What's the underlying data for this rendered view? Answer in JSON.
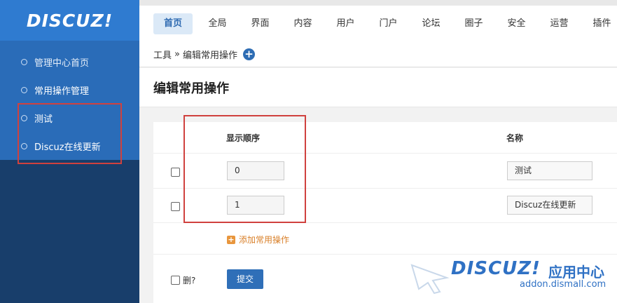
{
  "sidebar": {
    "logo": "DISCUZ!",
    "items": [
      {
        "label": "管理中心首页"
      },
      {
        "label": "常用操作管理"
      },
      {
        "label": "测试"
      },
      {
        "label": "Discuz在线更新"
      }
    ]
  },
  "topnav": {
    "tabs": [
      "首页",
      "全局",
      "界面",
      "内容",
      "用户",
      "门户",
      "论坛",
      "圈子",
      "安全",
      "运营",
      "插件"
    ],
    "active": "首页"
  },
  "breadcrumb": {
    "root": "工具",
    "separator": "»",
    "current": "编辑常用操作",
    "add_icon": "plus-circle-icon"
  },
  "page": {
    "title": "编辑常用操作"
  },
  "table": {
    "headers": {
      "order": "显示顺序",
      "name": "名称"
    },
    "rows": [
      {
        "order": "0",
        "name": "测试"
      },
      {
        "order": "1",
        "name": "Discuz在线更新"
      }
    ],
    "add_label": "添加常用操作",
    "delete_label": "删?",
    "submit_label": "提交"
  },
  "watermark": {
    "brand": "DISCUZ!",
    "suffix": "应用中心",
    "domain": "addon.dismall.com"
  },
  "colors": {
    "sidebar_bg": "#183e6b",
    "sidebar_highlight": "#2a6cb8",
    "accent": "#2f6fb8",
    "annotation_red": "#d0413e",
    "add_orange": "#e8963d"
  }
}
